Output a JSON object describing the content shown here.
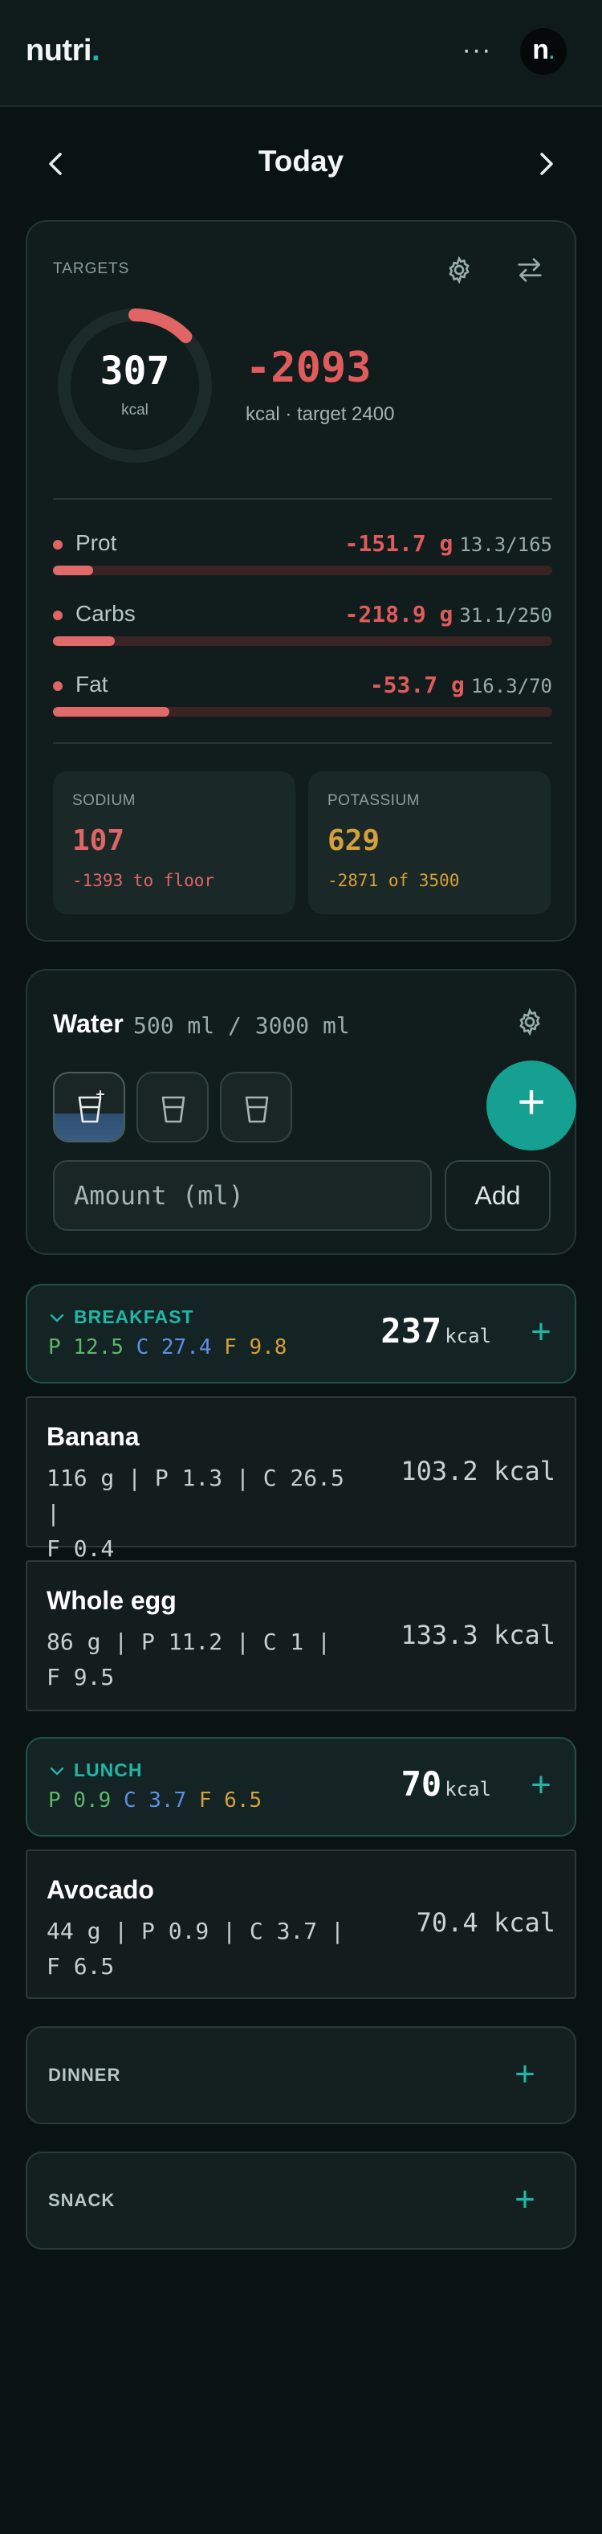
{
  "app": {
    "logo_text": "nutri",
    "logo_dot": ".",
    "avatar_letter": "n",
    "avatar_dot": "."
  },
  "header": {
    "more_icon": "more-horizontal-icon",
    "more_glyph": "···"
  },
  "date_nav": {
    "title": "Today",
    "prev_icon": "chevron-left-icon",
    "next_icon": "chevron-right-icon"
  },
  "targets": {
    "label": "TARGETS",
    "calories": {
      "consumed": "307",
      "unit": "kcal",
      "remaining": "-2093",
      "subtitle": "kcal · target 2400",
      "progress_fraction": 0.128
    },
    "macros": [
      {
        "name": "Prot",
        "delta": "-151.7 g",
        "ratio": "13.3/165",
        "fraction": 0.081
      },
      {
        "name": "Carbs",
        "delta": "-218.9 g",
        "ratio": "31.1/250",
        "fraction": 0.124
      },
      {
        "name": "Fat",
        "delta": "-53.7 g",
        "ratio": "16.3/70",
        "fraction": 0.233
      }
    ],
    "sodium": {
      "label": "SODIUM",
      "value": "107",
      "sub": "-1393 to floor",
      "color": "#e06666"
    },
    "potassium": {
      "label": "POTASSIUM",
      "value": "629",
      "sub": "-2871 of 3500",
      "color": "#d4a03a"
    }
  },
  "water": {
    "title": "Water",
    "amount": "500 ml / 3000 ml",
    "glasses": [
      {
        "filled": true
      },
      {
        "filled": false
      },
      {
        "filled": false
      }
    ],
    "add_fab": "+",
    "input_placeholder": "Amount (ml)",
    "add_label": "Add"
  },
  "meals": {
    "breakfast": {
      "name": "BREAKFAST",
      "p": "P 12.5",
      "c": "C 27.4",
      "f": "F 9.8",
      "kcal": "237",
      "kcal_unit": "kcal",
      "foods": [
        {
          "name": "Banana",
          "line1": "116 g | P 1.3 | C 26.5 |",
          "line2": "F 0.4",
          "kcal": "103.2 kcal"
        },
        {
          "name": "Whole egg",
          "line1": "86 g | P 11.2 | C 1 |",
          "line2": "F 9.5",
          "kcal": "133.3 kcal"
        }
      ]
    },
    "lunch": {
      "name": "LUNCH",
      "p": "P 0.9",
      "c": "C 3.7",
      "f": "F 6.5",
      "kcal": "70",
      "kcal_unit": "kcal",
      "foods": [
        {
          "name": "Avocado",
          "line1": "44 g | P 0.9 | C 3.7 |",
          "line2": "F 6.5",
          "kcal": "70.4 kcal"
        }
      ]
    },
    "dinner": {
      "name": "DINNER"
    },
    "snack": {
      "name": "SNACK"
    }
  },
  "colors": {
    "accent": "#20b7a8",
    "over": "#e05b5b",
    "protein": "#5eb86a",
    "carbs": "#5f8fe6",
    "fat": "#d4a03a"
  }
}
